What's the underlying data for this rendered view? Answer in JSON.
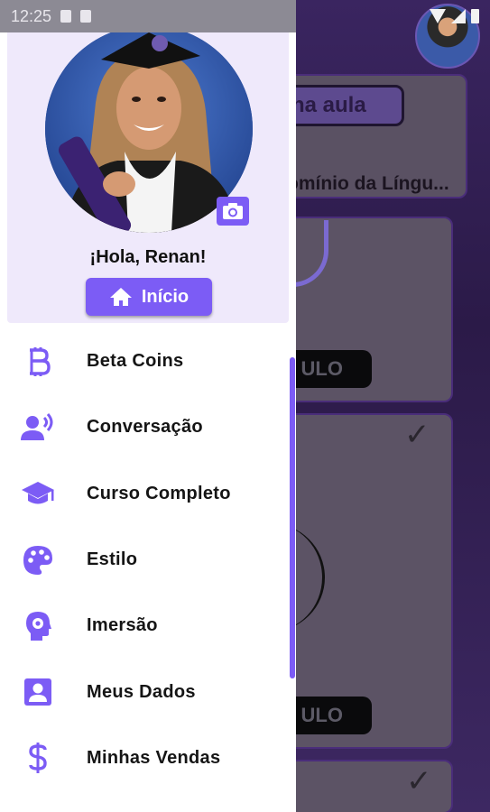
{
  "status_bar": {
    "time": "12:25"
  },
  "background_app": {
    "button_partial": "na aula",
    "lesson_title_partial": "omínio da Língu...",
    "card_button_1": "ULO",
    "card_button_2": "ULO"
  },
  "drawer": {
    "greeting": "¡Hola, Renan!",
    "home_button": "Início",
    "menu": [
      {
        "label": "Beta Coins",
        "icon": "bitcoin-icon"
      },
      {
        "label": "Conversação",
        "icon": "speaking-person-icon"
      },
      {
        "label": "Curso Completo",
        "icon": "graduation-cap-icon"
      },
      {
        "label": "Estilo",
        "icon": "palette-icon"
      },
      {
        "label": "Imersão",
        "icon": "head-gear-icon"
      },
      {
        "label": "Meus Dados",
        "icon": "contact-card-icon"
      },
      {
        "label": "Minhas Vendas",
        "icon": "dollar-icon"
      }
    ]
  },
  "colors": {
    "accent": "#7c5cf5",
    "header_bg": "#efe9fb",
    "text": "#151515"
  }
}
